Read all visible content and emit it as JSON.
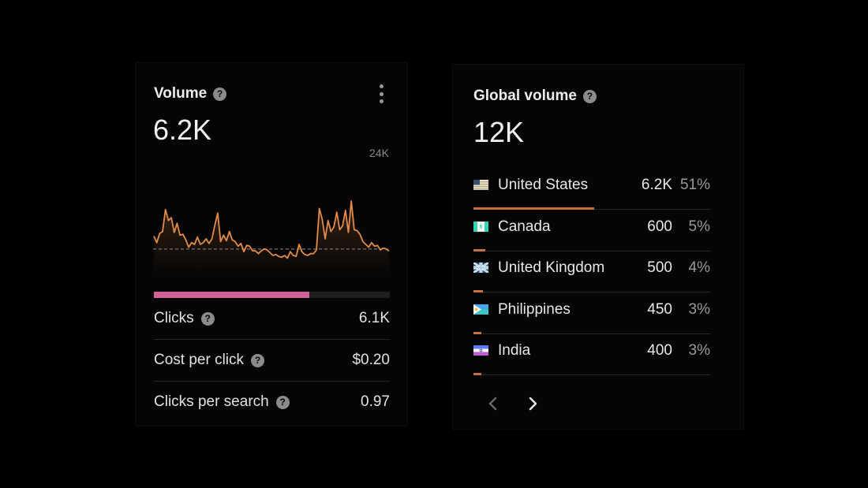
{
  "volume_card": {
    "title": "Volume",
    "value": "6.2K",
    "axis_max_label": "24K",
    "clicks_share": 0.66,
    "metrics": [
      {
        "label": "Clicks",
        "value": "6.1K",
        "has_help": true
      },
      {
        "label": "Cost per click",
        "value": "$0.20",
        "has_help": true
      },
      {
        "label": "Clicks per search",
        "value": "0.97",
        "has_help": true
      }
    ],
    "help_glyph": "?"
  },
  "chart_data": {
    "type": "line",
    "ylim": [
      0,
      24000
    ],
    "average": 6200,
    "values": [
      9000,
      7600,
      9600,
      10000,
      14800,
      12400,
      13000,
      9800,
      11800,
      9200,
      9400,
      8200,
      6600,
      7600,
      7200,
      8800,
      7200,
      7600,
      8400,
      7400,
      8400,
      11400,
      14000,
      7800,
      9200,
      8000,
      10000,
      8200,
      7800,
      6800,
      7400,
      5600,
      7000,
      6800,
      5800,
      5800,
      5200,
      5800,
      6200,
      6000,
      5400,
      4800,
      5000,
      4600,
      4400,
      4800,
      4200,
      5600,
      4800,
      4600,
      7200,
      5600,
      5000,
      4800,
      5200,
      5200,
      6000,
      15000,
      12600,
      8400,
      12400,
      10000,
      11000,
      14200,
      10400,
      11200,
      14600,
      9800,
      16600,
      10400,
      10200,
      9400,
      7800,
      7200,
      6600,
      7600,
      6800,
      7000,
      6000,
      6400,
      6200,
      5800
    ],
    "line_color": "#e28b48",
    "average_line_color": "#8c8c8c"
  },
  "global_card": {
    "title": "Global volume",
    "value": "12K",
    "countries": [
      {
        "name": "United States",
        "volume": "6.2K",
        "percent": "51%",
        "share": 0.51,
        "flag_icon": "us-flag-icon"
      },
      {
        "name": "Canada",
        "volume": "600",
        "percent": "5%",
        "share": 0.05,
        "flag_icon": "ca-flag-icon"
      },
      {
        "name": "United Kingdom",
        "volume": "500",
        "percent": "4%",
        "share": 0.04,
        "flag_icon": "gb-flag-icon"
      },
      {
        "name": "Philippines",
        "volume": "450",
        "percent": "3%",
        "share": 0.03,
        "flag_icon": "ph-flag-icon"
      },
      {
        "name": "India",
        "volume": "400",
        "percent": "3%",
        "share": 0.03,
        "flag_icon": "in-flag-icon"
      }
    ],
    "pagination": {
      "prev_icon": "chevron-left-icon",
      "next_icon": "chevron-right-icon",
      "prev_enabled": false,
      "next_enabled": true
    }
  },
  "colors": {
    "background": "#000000",
    "card": "#050505",
    "accent_orange": "#c8713b",
    "clicks_bar": "#d2609a",
    "divider": "#262626"
  }
}
